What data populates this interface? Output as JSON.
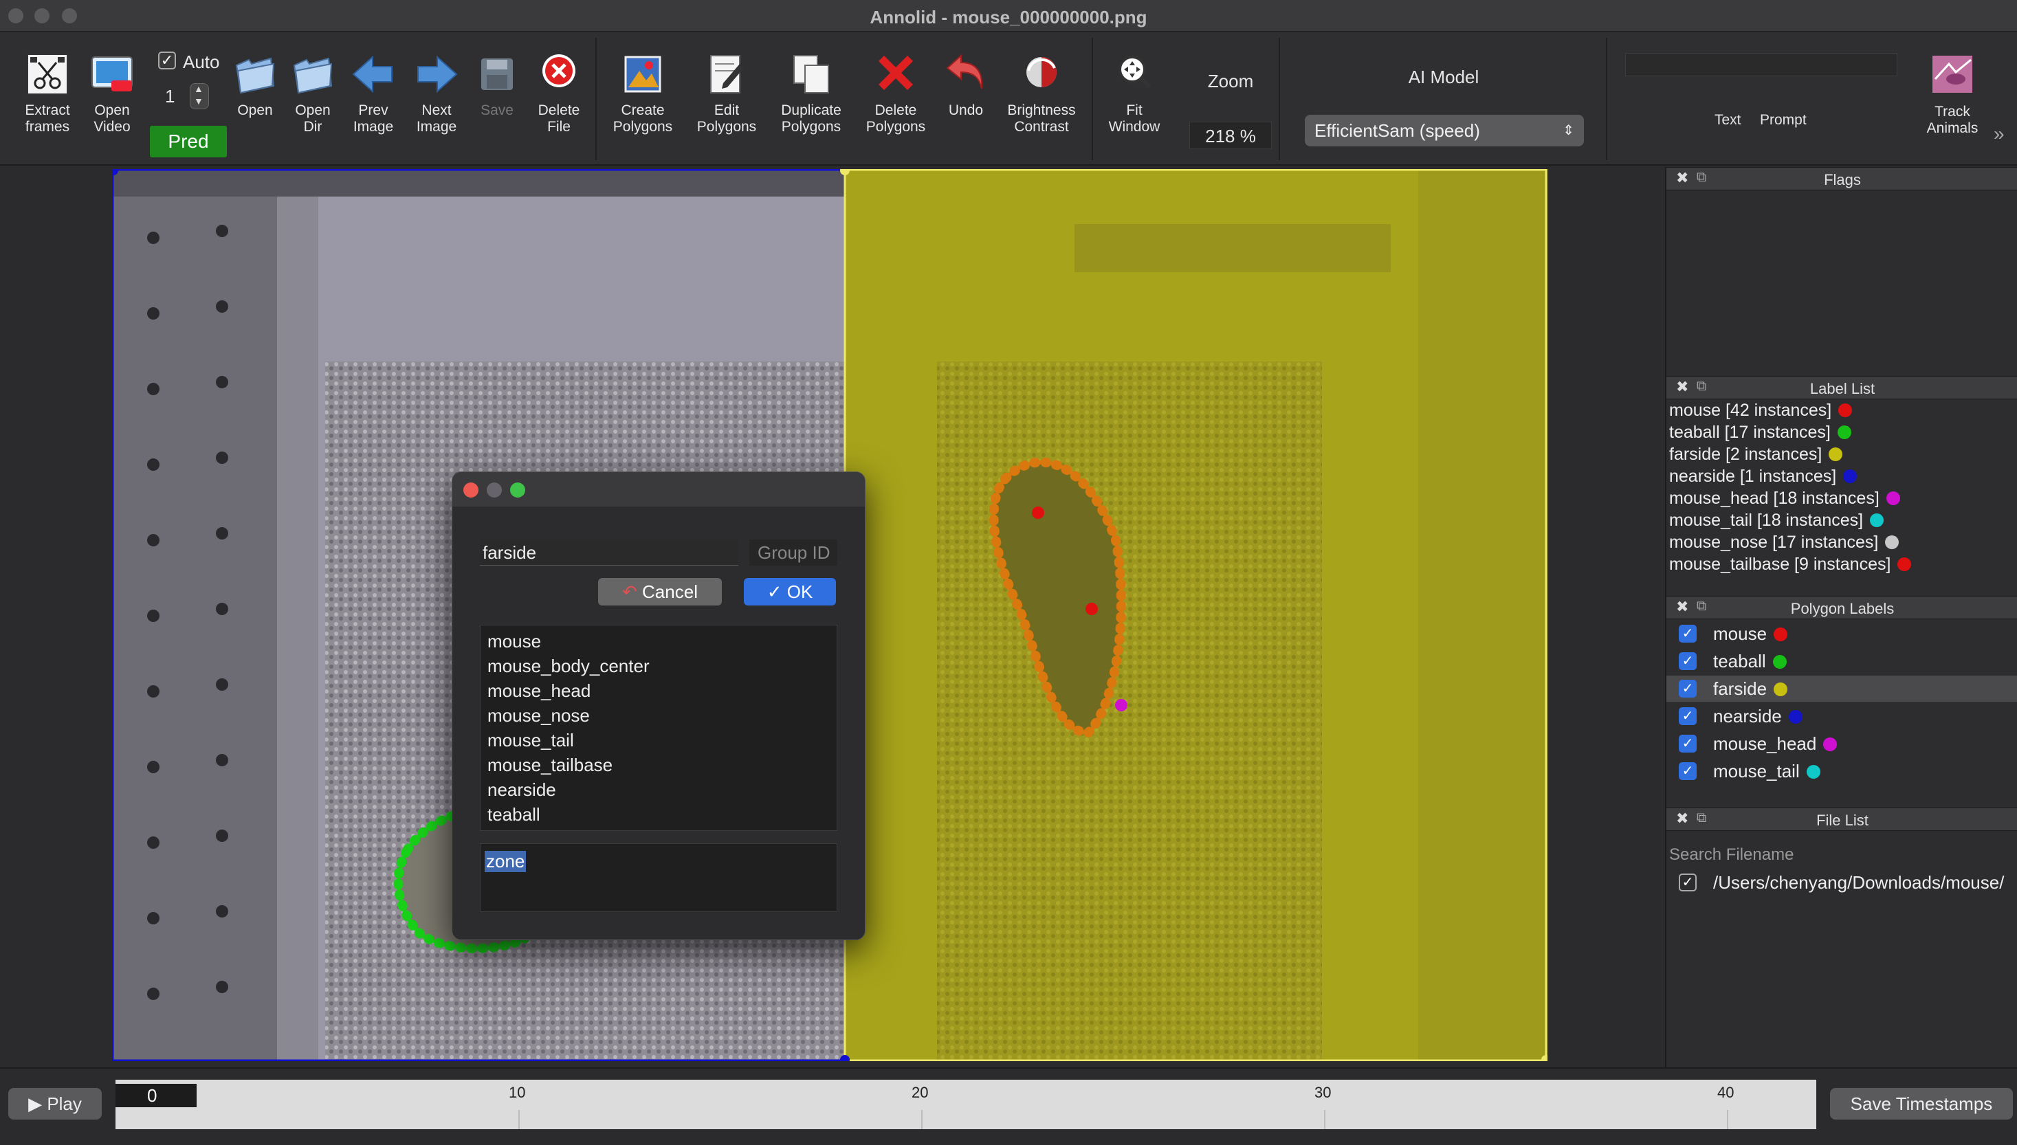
{
  "window": {
    "title": "Annolid - mouse_000000000.png"
  },
  "toolbar": {
    "extract_frames": "Extract\nframes",
    "open_video": "Open\nVideo",
    "auto_label": "Auto",
    "auto_checked": true,
    "spin_value": "1",
    "pred": "Pred",
    "open": "Open",
    "open_dir": "Open\nDir",
    "prev_image": "Prev\nImage",
    "next_image": "Next\nImage",
    "save": "Save",
    "delete_file": "Delete\nFile",
    "create_polygons": "Create\nPolygons",
    "edit_polygons": "Edit\nPolygons",
    "duplicate_polygons": "Duplicate\nPolygons",
    "delete_polygons": "Delete\nPolygons",
    "undo": "Undo",
    "brightness_contrast": "Brightness\nContrast",
    "fit_window": "Fit\nWindow",
    "zoom_label": "Zoom",
    "zoom_value": "218 %",
    "ai_model_label": "AI Model",
    "ai_model_value": "EfficientSam (speed)",
    "text_label": "Text",
    "prompt_label": "Prompt",
    "track_animals": "Track\nAnimals"
  },
  "flags_panel": {
    "title": "Flags"
  },
  "label_list": {
    "title": "Label List",
    "items": [
      {
        "text": "mouse [42 instances]",
        "color": "#e01010"
      },
      {
        "text": "teaball [17 instances]",
        "color": "#16c016"
      },
      {
        "text": "farside [2 instances]",
        "color": "#c8c010"
      },
      {
        "text": "nearside [1 instances]",
        "color": "#1414c8"
      },
      {
        "text": "mouse_head [18 instances]",
        "color": "#d010d0"
      },
      {
        "text": "mouse_tail [18 instances]",
        "color": "#10c8c8"
      },
      {
        "text": "mouse_nose [17 instances]",
        "color": "#c8c8c8"
      },
      {
        "text": "mouse_tailbase [9 instances]",
        "color": "#e01010"
      }
    ]
  },
  "polygon_labels": {
    "title": "Polygon Labels",
    "items": [
      {
        "text": "mouse",
        "color": "#e01010"
      },
      {
        "text": "teaball",
        "color": "#16c016"
      },
      {
        "text": "farside",
        "color": "#c8c010"
      },
      {
        "text": "nearside",
        "color": "#1414c8"
      },
      {
        "text": "mouse_head",
        "color": "#d010d0"
      },
      {
        "text": "mouse_tail",
        "color": "#10c8c8"
      }
    ]
  },
  "file_list": {
    "title": "File List",
    "search_placeholder": "Search Filename",
    "file": "/Users/chenyang/Downloads/mouse/"
  },
  "dialog": {
    "label_value": "farside",
    "group_id_placeholder": "Group ID",
    "cancel": "Cancel",
    "ok": "OK",
    "labels": [
      "mouse",
      "mouse_body_center",
      "mouse_head",
      "mouse_nose",
      "mouse_tail",
      "mouse_tailbase",
      "nearside",
      "teaball"
    ],
    "description": "zone"
  },
  "timeline": {
    "play": "Play",
    "current_frame": "0",
    "ticks": [
      "10",
      "20",
      "30",
      "40"
    ],
    "save_timestamps": "Save Timestamps"
  }
}
